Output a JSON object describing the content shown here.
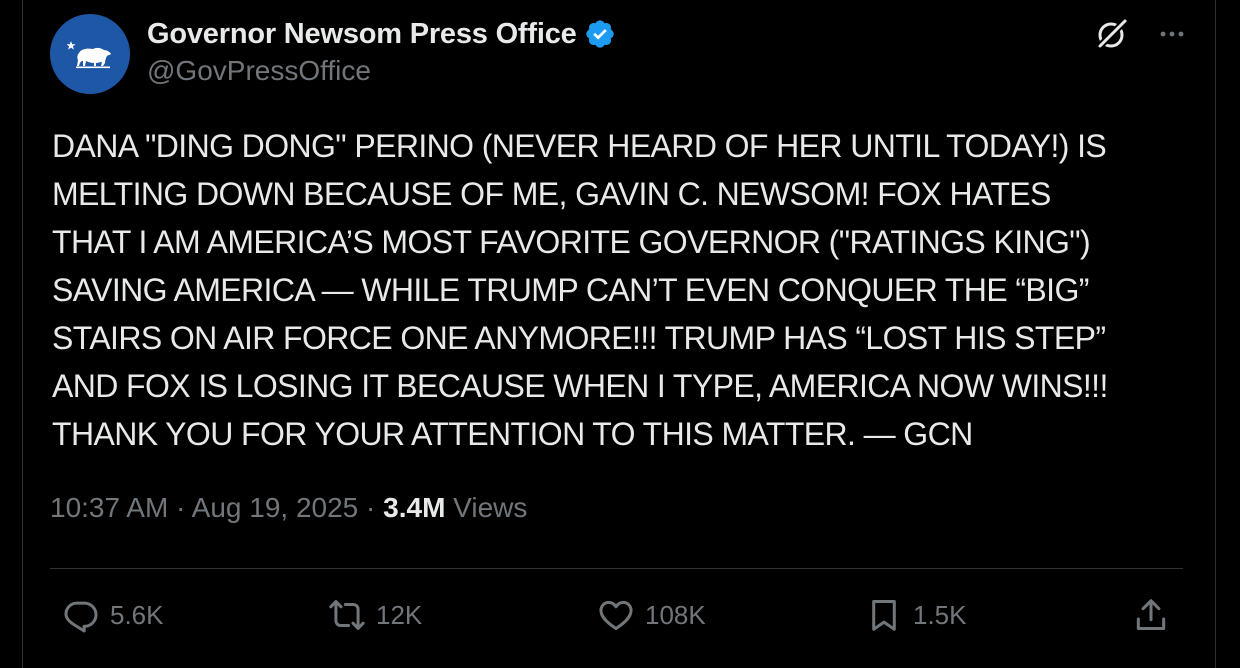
{
  "author": {
    "display_name": "Governor Newsom Press Office",
    "handle": "@GovPressOffice",
    "verified": true,
    "avatar_icon": "california-bear-icon",
    "avatar_color": "#1d57a6"
  },
  "tweet": {
    "lines": [
      "DANA \"DING DONG\" PERINO (NEVER HEARD OF HER UNTIL TODAY!) IS",
      "MELTING DOWN BECAUSE OF ME, GAVIN C. NEWSOM! FOX HATES",
      "THAT I AM AMERICA’S MOST FAVORITE GOVERNOR (\"RATINGS KING\")",
      "SAVING AMERICA — WHILE TRUMP CAN’T EVEN CONQUER THE “BIG”",
      "STAIRS ON AIR FORCE ONE ANYMORE!!! TRUMP HAS “LOST HIS STEP”",
      "AND FOX IS LOSING IT BECAUSE WHEN I TYPE, AMERICA NOW WINS!!!",
      "THANK YOU FOR YOUR ATTENTION TO THIS MATTER. — GCN"
    ]
  },
  "meta": {
    "time": "10:37 AM",
    "separator": "·",
    "date": "Aug 19, 2025",
    "views_count": "3.4M",
    "views_label": "Views"
  },
  "actions": {
    "replies": "5.6K",
    "reposts": "12K",
    "likes": "108K",
    "bookmarks": "1.5K"
  },
  "colors": {
    "background": "#000000",
    "text": "#e7e9ea",
    "secondary": "#71767b",
    "verified": "#1d9bf0",
    "divider": "#2f3336"
  },
  "icons": {
    "header": [
      "grok-icon",
      "more-icon"
    ],
    "actions": [
      "reply-icon",
      "repost-icon",
      "like-icon",
      "bookmark-icon",
      "share-icon"
    ]
  }
}
